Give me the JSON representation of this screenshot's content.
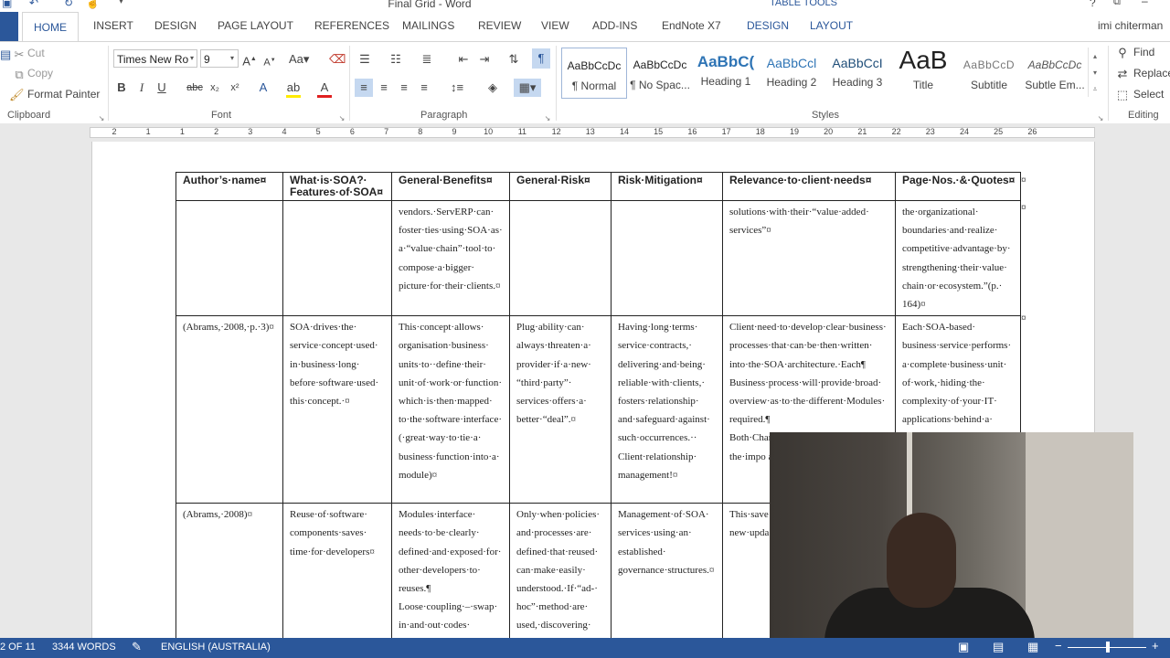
{
  "window": {
    "title": "Final Grid - Word",
    "context_tab_group": "TABLE TOOLS",
    "user": "imi chiterman"
  },
  "tabs": [
    "HOME",
    "INSERT",
    "DESIGN",
    "PAGE LAYOUT",
    "REFERENCES",
    "MAILINGS",
    "REVIEW",
    "VIEW",
    "ADD-INS",
    "EndNote X7",
    "DESIGN",
    "LAYOUT"
  ],
  "clipboard": {
    "cut": "Cut",
    "copy": "Copy",
    "format_painter": "Format Painter",
    "label": "Clipboard"
  },
  "font": {
    "name": "Times New Ro",
    "size": "9",
    "label": "Font"
  },
  "paragraph": {
    "label": "Paragraph"
  },
  "styles": {
    "label": "Styles",
    "items": [
      {
        "preview": "AaBbCcDc",
        "name": "¶ Normal"
      },
      {
        "preview": "AaBbCcDc",
        "name": "¶ No Spac..."
      },
      {
        "preview": "AaBbC(",
        "name": "Heading 1"
      },
      {
        "preview": "AaBbCcl",
        "name": "Heading 2"
      },
      {
        "preview": "AaBbCcI",
        "name": "Heading 3"
      },
      {
        "preview": "AaB",
        "name": "Title"
      },
      {
        "preview": "AaBbCcD",
        "name": "Subtitle"
      },
      {
        "preview": "AaBbCcDc",
        "name": "Subtle Em..."
      }
    ]
  },
  "editing": {
    "find": "Find",
    "replace": "Replace",
    "select": "Select",
    "label": "Editing"
  },
  "ruler": [
    "2",
    "1",
    "1",
    "2",
    "3",
    "4",
    "5",
    "6",
    "7",
    "8",
    "9",
    "10",
    "11",
    "12",
    "13",
    "14",
    "15",
    "16",
    "17",
    "18",
    "19",
    "20",
    "21",
    "22",
    "23",
    "24",
    "25",
    "26"
  ],
  "table": {
    "headers": [
      "Author’s·name¤",
      "What·is·SOA?· Features·of·SOA¤",
      "General·Benefits¤",
      "General·Risk¤",
      "Risk·Mitigation¤",
      "Relevance·to·client·needs¤",
      "Page·Nos.·&·Quotes¤"
    ],
    "rows": [
      [
        "",
        "",
        "vendors.·ServERP·can· foster·ties·using·SOA·as· a·“value·chain”·tool·to· compose·a·bigger· picture·for·their·clients.¤",
        "",
        "",
        "solutions·with·their·“value·added· services”¤",
        "the·organizational· boundaries·and·realize· competitive·advantage·by· strengthening·their·value· chain·or·ecosystem.”(p.· 164)¤"
      ],
      [
        "(Abrams,·2008,·p.·3)¤",
        "SOA·drives·the· service·concept·used· in·business·long· before·software·used· this·concept.·¤",
        "This·concept·allows· organisation·business· units·to··define·their· unit·of·work·or·function· which·is·then·mapped· to·the·software·interface· (·great·way·to·tie·a· business·function·into·a· module)¤",
        "Plug·ability·can· always·threaten·a· provider·if·a·new· “third·party”· services·offers·a· better·“deal”.¤",
        "Having·long·terms· service·contracts,· delivering·and·being· reliable·with·clients,· fosters·relationship· and·safeguard·against· such·occurrences.·· Client·relationship· management!¤",
        "Client·need·to·develop·clear·business· processes·that·can·be·then·written· into·the·SOA·architecture.·Each¶ Business·process·will·provide·broad· overview·as·to·the·different·Modules· required.¶ Both·Charles·and·Heffner·discuss· the·impo aspects·o concept.",
        "Each·SOA-based· business·service·performs· a·complete·business·unit· of·work,·hiding·the· complexity·of·your·IT· applications·behind·a· pluggable,·digital·"
      ],
      [
        "(Abrams,·2008)¤",
        "Reuse·of·software· components·saves· time·for·developers¤",
        "Modules·interface· needs·to·be·clearly· defined·and·exposed·for· other·developers·to· reuses.¶ Loose·coupling·–·swap· in·and·out·codes· without·breaking·the·",
        "Only·when·policies· and·processes·are· defined·that·reused· can·make·easily· understood.·If·“ad-· hoc”·method·are· used,·discovering· services·may·be·",
        "Management·of·SOA· services·using·an· established· governance·structures.¤",
        "This·save simple·“ Higher·le High·upt new·upda may·not· backend.",
        ""
      ]
    ]
  },
  "status": {
    "page": "2 OF 11",
    "words": "3344 WORDS",
    "language": "ENGLISH (AUSTRALIA)"
  }
}
